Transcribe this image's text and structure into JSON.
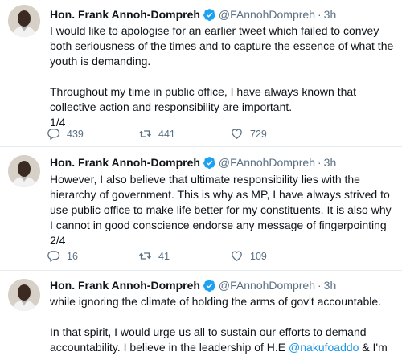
{
  "tweets": [
    {
      "name": "Hon. Frank Annoh-Dompreh",
      "handle": "@FAnnohDompreh",
      "separator": "·",
      "time": "3h",
      "text": "I would like to apologise for an earlier tweet which failed to convey both seriousness of the times and to capture the essence of what the youth is demanding.\n\nThroughout my time in public office, I have always known that collective action and responsibility are important.\n1/4",
      "replies": "439",
      "retweets": "441",
      "likes": "729"
    },
    {
      "name": "Hon. Frank Annoh-Dompreh",
      "handle": "@FAnnohDompreh",
      "separator": "·",
      "time": "3h",
      "text": "However, I also believe that ultimate responsibility lies with the hierarchy of government. This is why as MP, I have always strived to use public office to make life better for my constituents. It is also why I cannot in good conscience endorse any message of fingerpointing\n2/4",
      "replies": "16",
      "retweets": "41",
      "likes": "109"
    },
    {
      "name": "Hon. Frank Annoh-Dompreh",
      "handle": "@FAnnohDompreh",
      "separator": "·",
      "time": "3h",
      "text_a": "while ignoring the climate of holding the arms of gov't accountable.\n\nIn that spirit, I would urge us all to sustain our efforts to demand accountability. I believe in the leadership of H.E ",
      "mention": "@nakufoaddo",
      "text_b": " & I'm confident that the responsible and responsive leadership he has"
    }
  ],
  "icons": {
    "verified": "verified-badge-icon",
    "reply": "reply-icon",
    "retweet": "retweet-icon",
    "like": "heart-icon"
  },
  "colors": {
    "verified": "#1da1f2",
    "mention": "#1b95e0",
    "muted": "#5b7083",
    "divider": "#e6ecf0"
  }
}
